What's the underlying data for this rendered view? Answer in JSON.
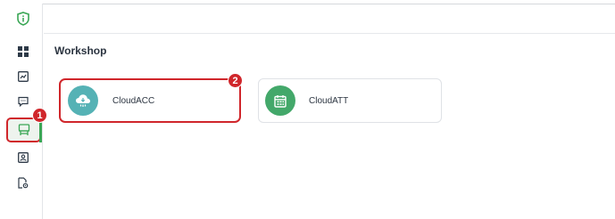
{
  "sidebar": {
    "logo": {
      "icon": "shield-info-icon"
    },
    "items": [
      {
        "id": "dashboard",
        "icon": "grid-icon"
      },
      {
        "id": "reports",
        "icon": "doc-chart-icon"
      },
      {
        "id": "messages",
        "icon": "chat-icon"
      },
      {
        "id": "workshop",
        "icon": "workshop-icon",
        "active": true
      },
      {
        "id": "contacts",
        "icon": "contact-card-icon"
      },
      {
        "id": "settings",
        "icon": "file-gear-icon"
      }
    ],
    "active_marker": "1"
  },
  "main": {
    "section_title": "Workshop",
    "apps": [
      {
        "label": "CloudACC",
        "icon": "cloud-icon",
        "color": "#55b2b5",
        "selected": true,
        "marker": "2"
      },
      {
        "label": "CloudATT",
        "icon": "calendar-icon",
        "color": "#43a86a",
        "selected": false
      }
    ]
  },
  "colors": {
    "highlight": "#d0262b",
    "active_indicator": "#3aa655"
  }
}
